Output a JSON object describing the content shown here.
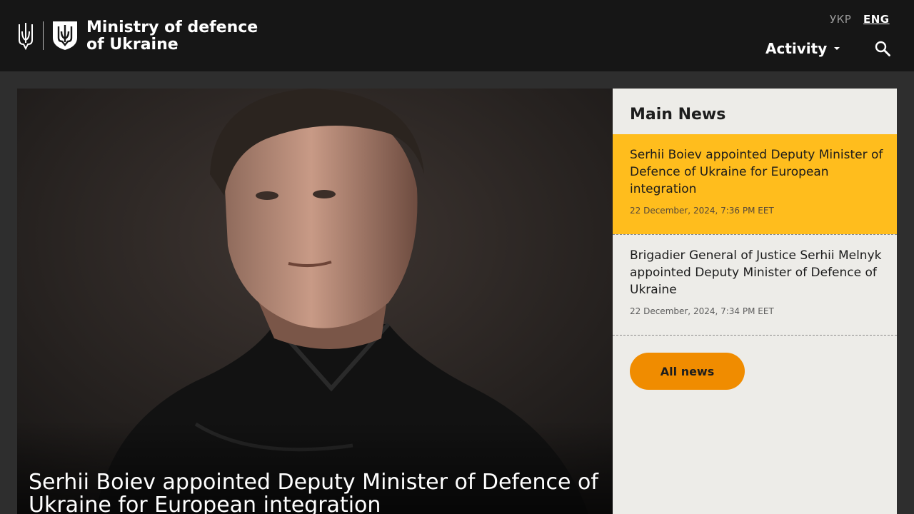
{
  "header": {
    "brand_line1": "Ministry of defence",
    "brand_line2": "of Ukraine",
    "lang_ukr": "УКР",
    "lang_eng": "ENG",
    "nav_activity": "Activity"
  },
  "hero": {
    "title": "Serhii Boiev appointed Deputy Minister of Defence of Ukraine for European integration"
  },
  "main_news": {
    "heading": "Main News",
    "items": [
      {
        "title": "Serhii Boiev appointed Deputy Minister of Defence of Ukraine for European integration",
        "date": "22 December, 2024, 7:36 PM EET",
        "active": true
      },
      {
        "title": "Brigadier General of Justice Serhii Melnyk appointed Deputy Minister of Defence of Ukraine",
        "date": "22 December, 2024, 7:34 PM EET",
        "active": false
      }
    ],
    "all_news_label": "All news"
  },
  "icons": {
    "trident": "trident-icon",
    "shield": "shield-logo-icon",
    "search": "search-icon",
    "caret": "chevron-down-icon"
  },
  "colors": {
    "header_bg": "#161616",
    "accent_yellow": "#ffbd1d",
    "button_orange": "#f08c00",
    "sidebar_bg": "#edece8"
  }
}
